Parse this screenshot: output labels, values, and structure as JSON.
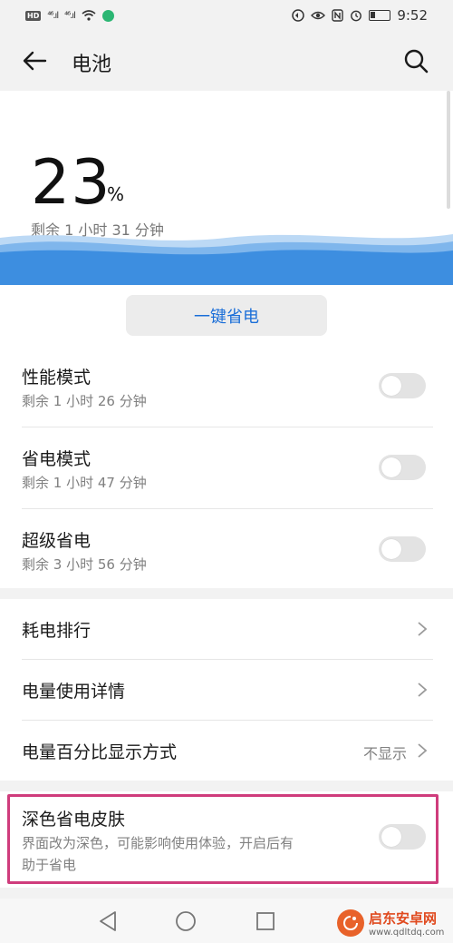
{
  "status_bar": {
    "hd_badge": "HD",
    "signal_1": "⁴⁶.ıl",
    "signal_2": "⁴⁶.ıl",
    "time": "9:52"
  },
  "header": {
    "title": "电池"
  },
  "battery": {
    "percent": "23",
    "unit": "%",
    "remaining": "剩余 1 小时 31 分钟",
    "level": 0.23
  },
  "one_key_button": "一键省电",
  "modes": [
    {
      "title": "性能模式",
      "subtitle": "剩余 1 小时 26 分钟",
      "enabled": false
    },
    {
      "title": "省电模式",
      "subtitle": "剩余 1 小时 47 分钟",
      "enabled": false
    },
    {
      "title": "超级省电",
      "subtitle": "剩余 3 小时 56 分钟",
      "enabled": false
    }
  ],
  "links": [
    {
      "title": "耗电排行"
    },
    {
      "title": "电量使用详情"
    },
    {
      "title": "电量百分比显示方式",
      "value": "不显示"
    }
  ],
  "dark_skin": {
    "title": "深色省电皮肤",
    "description_line1": "界面改为深色，可能影响使用体验，开启后有",
    "description_line2": "助于省电",
    "enabled": false
  },
  "watermark": {
    "name": "启东安卓网",
    "url": "www.qdltdq.com"
  },
  "colors": {
    "accent": "#1a6ed8",
    "highlight": "#cf3c7c",
    "wave": "#3d8ee0"
  }
}
